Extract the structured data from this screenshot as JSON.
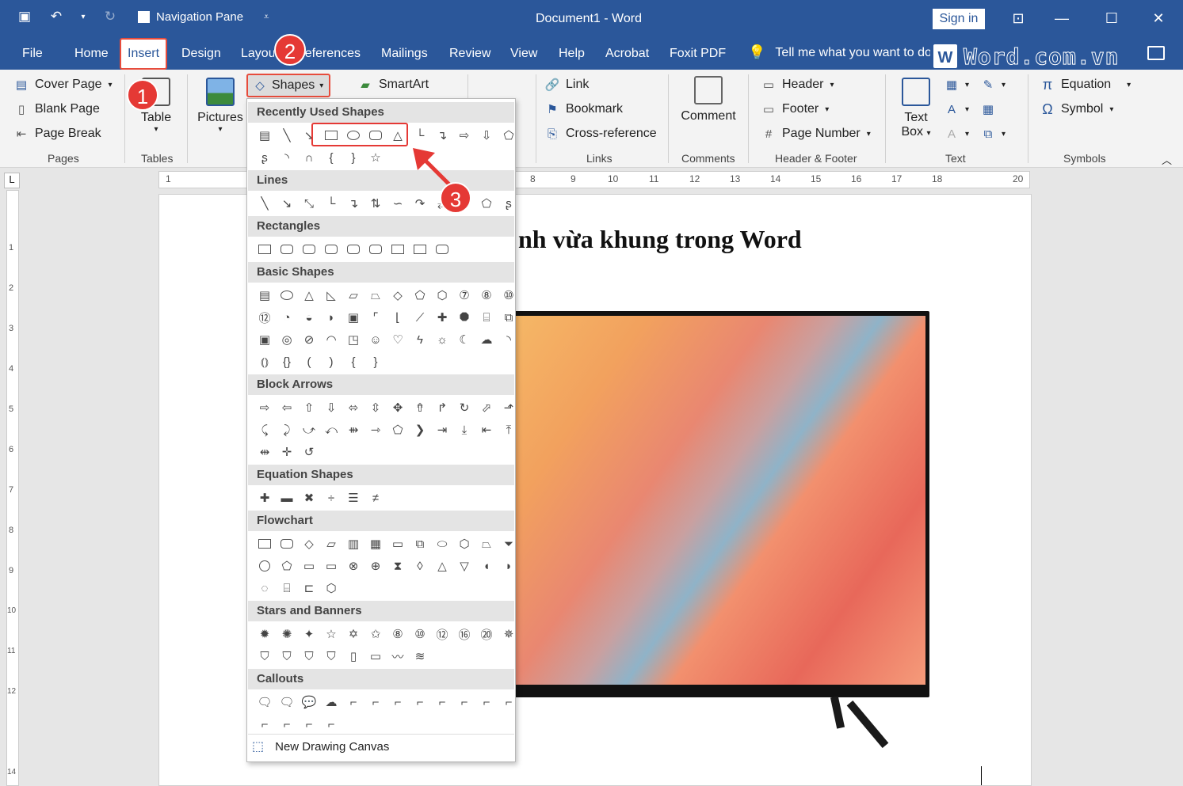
{
  "titlebar": {
    "nav_pane_label": "Navigation Pane",
    "doc_title": "Document1  -  Word",
    "sign_in": "Sign in"
  },
  "tabs": [
    "File",
    "Home",
    "Insert",
    "Design",
    "Layout",
    "References",
    "Mailings",
    "Review",
    "View",
    "Help",
    "Acrobat",
    "Foxit PDF"
  ],
  "tell_me": "Tell me what you want to do",
  "watermark": "Word.com.vn",
  "ribbon": {
    "pages": {
      "cover_page": "Cover Page",
      "blank_page": "Blank Page",
      "page_break": "Page Break",
      "label": "Pages"
    },
    "tables": {
      "table": "Table",
      "label": "Tables"
    },
    "pictures": "Pictures",
    "shapes": "Shapes",
    "smartart": "SmartArt",
    "links": {
      "link": "Link",
      "bookmark": "Bookmark",
      "cross_reference": "Cross-reference",
      "label": "Links"
    },
    "comments": {
      "comment": "Comment",
      "label": "Comments"
    },
    "header_footer": {
      "header": "Header",
      "footer": "Footer",
      "page_number": "Page Number",
      "label": "Header & Footer"
    },
    "text": {
      "text_box": "Text",
      "text_box2": "Box",
      "label": "Text"
    },
    "symbols": {
      "equation": "Equation",
      "symbol": "Symbol",
      "label": "Symbols"
    }
  },
  "badges": [
    "1",
    "2",
    "3"
  ],
  "ruler": {
    "top_ticks": [
      "1",
      "8",
      "9",
      "10",
      "11",
      "12",
      "13",
      "14",
      "15",
      "16",
      "17",
      "18",
      "20"
    ],
    "left_ticks": [
      "1",
      "2",
      "3",
      "4",
      "5",
      "6",
      "7",
      "8",
      "9",
      "10",
      "11",
      "12",
      "14"
    ]
  },
  "document": {
    "heading_visible": "nh vừa khung trong Word"
  },
  "shapes_menu": {
    "sections": [
      "Recently Used Shapes",
      "Lines",
      "Rectangles",
      "Basic Shapes",
      "Block Arrows",
      "Equation Shapes",
      "Flowchart",
      "Stars and Banners",
      "Callouts"
    ],
    "new_canvas": "New Drawing Canvas"
  },
  "colors": {
    "accent": "#2b579a",
    "highlight": "#e53935"
  }
}
